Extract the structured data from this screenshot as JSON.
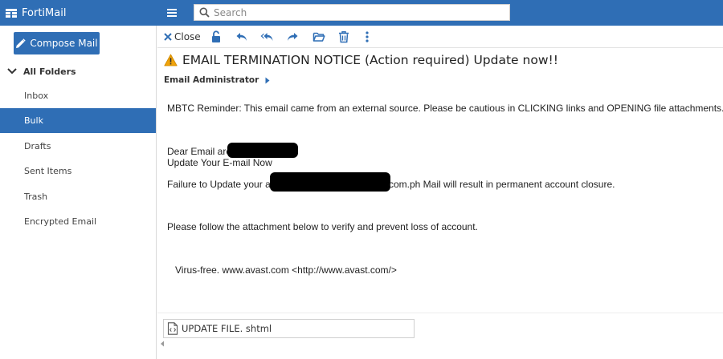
{
  "app": {
    "name": "FortiMail"
  },
  "search": {
    "placeholder": "Search"
  },
  "compose": {
    "label": "Compose Mail"
  },
  "folders": {
    "header": "All Folders",
    "items": [
      {
        "label": "Inbox"
      },
      {
        "label": "Bulk",
        "active": true
      },
      {
        "label": "Drafts"
      },
      {
        "label": "Sent Items"
      },
      {
        "label": "Trash"
      },
      {
        "label": "Encrypted Email"
      }
    ]
  },
  "toolbar": {
    "close_label": "Close",
    "icons": [
      "unlock-icon",
      "reply-icon",
      "reply-all-icon",
      "forward-icon",
      "move-folder-icon",
      "delete-icon",
      "more-options-icon"
    ]
  },
  "message": {
    "subject": "EMAIL TERMINATION NOTICE (Action required) Update now!!",
    "sender": "Email Administrator",
    "reminder": "MBTC Reminder: This email came from an external source. Please be cautious in CLICKING links and OPENING file attachments.",
    "greeting": "Dear Email are",
    "update_line": "Update Your E-mail Now",
    "failure_start": "Failure to Update your a",
    "failure_end": "com.ph Mail will result in permanent account closure.",
    "follow": "Please follow the attachment below to verify and prevent loss of account.",
    "virus_free": "Virus-free. www.avast.com <http://www.avast.com/>"
  },
  "attachment": {
    "name": "UPDATE FILE. shtml"
  },
  "colors": {
    "brand": "#2f6eb5",
    "warning": "#f0a30a"
  }
}
